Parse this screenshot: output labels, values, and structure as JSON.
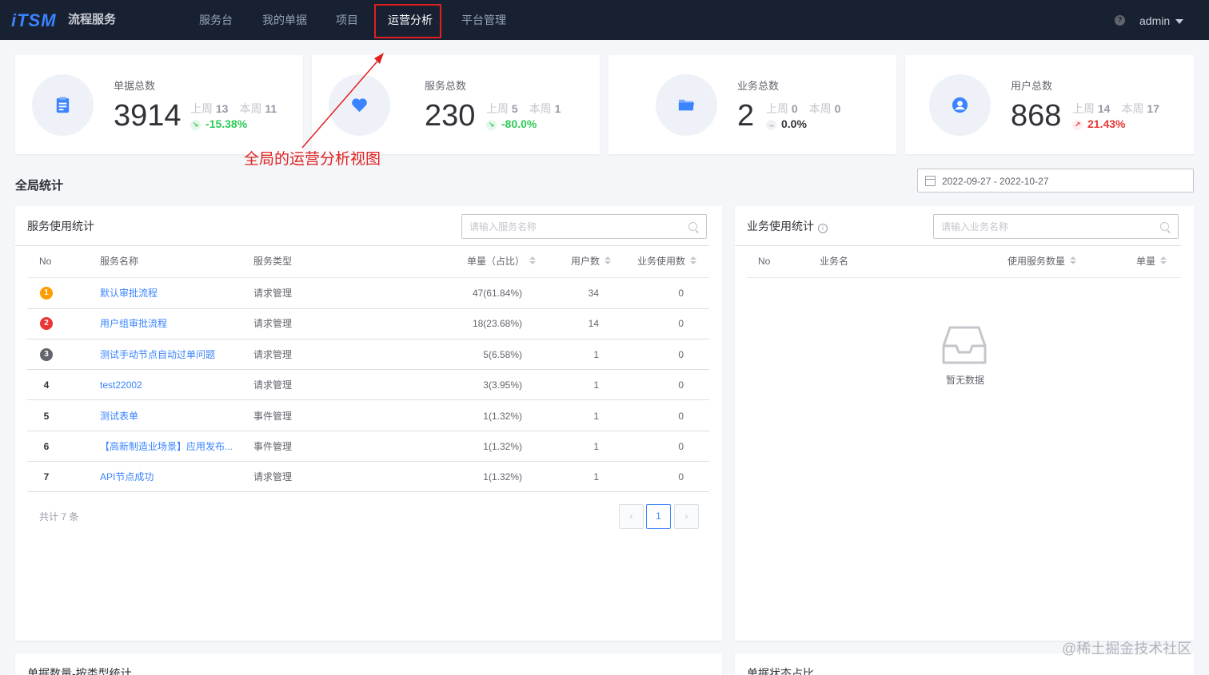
{
  "app": {
    "logo": "iTSM",
    "name": "流程服务"
  },
  "nav": {
    "items": [
      {
        "label": "服务台"
      },
      {
        "label": "我的单据"
      },
      {
        "label": "项目"
      },
      {
        "label": "运营分析"
      },
      {
        "label": "平台管理"
      }
    ],
    "active_index": 3,
    "user": "admin"
  },
  "stats": [
    {
      "label": "单据总数",
      "value": "3914",
      "last_week_label": "上周",
      "last_week": "13",
      "this_week_label": "本周",
      "this_week": "11",
      "change": "-15.38%",
      "trend": "down",
      "icon": "clipboard-icon"
    },
    {
      "label": "服务总数",
      "value": "230",
      "last_week_label": "上周",
      "last_week": "5",
      "this_week_label": "本周",
      "this_week": "1",
      "change": "-80.0%",
      "trend": "down",
      "icon": "heart-icon"
    },
    {
      "label": "业务总数",
      "value": "2",
      "last_week_label": "上周",
      "last_week": "0",
      "this_week_label": "本周",
      "this_week": "0",
      "change": "0.0%",
      "trend": "flat",
      "icon": "folder-icon"
    },
    {
      "label": "用户总数",
      "value": "868",
      "last_week_label": "上周",
      "last_week": "14",
      "this_week_label": "本周",
      "this_week": "17",
      "change": "21.43%",
      "trend": "up",
      "icon": "user-icon"
    }
  ],
  "annotation": "全局的运营分析视图",
  "section": {
    "title": "全局统计",
    "date_range": "2022-09-27 - 2022-10-27"
  },
  "service_panel": {
    "title": "服务使用统计",
    "search_placeholder": "请输入服务名称",
    "columns": [
      "No",
      "服务名称",
      "服务类型",
      "单量（占比）",
      "用户数",
      "业务使用数"
    ],
    "rows": [
      {
        "no": "1",
        "name": "默认审批流程",
        "type": "请求管理",
        "count": "47(61.84%)",
        "users": "34",
        "biz": "0"
      },
      {
        "no": "2",
        "name": "用户组审批流程",
        "type": "请求管理",
        "count": "18(23.68%)",
        "users": "14",
        "biz": "0"
      },
      {
        "no": "3",
        "name": "测试手动节点自动过单问题",
        "type": "请求管理",
        "count": "5(6.58%)",
        "users": "1",
        "biz": "0"
      },
      {
        "no": "4",
        "name": "test22002",
        "type": "请求管理",
        "count": "3(3.95%)",
        "users": "1",
        "biz": "0"
      },
      {
        "no": "5",
        "name": "测试表单",
        "type": "事件管理",
        "count": "1(1.32%)",
        "users": "1",
        "biz": "0"
      },
      {
        "no": "6",
        "name": "【高新制造业场景】应用发布...",
        "type": "事件管理",
        "count": "1(1.32%)",
        "users": "1",
        "biz": "0"
      },
      {
        "no": "7",
        "name": "API节点成功",
        "type": "请求管理",
        "count": "1(1.32%)",
        "users": "1",
        "biz": "0"
      }
    ],
    "total": "共计 7 条",
    "page": "1",
    "prev": "‹",
    "next": "›"
  },
  "business_panel": {
    "title": "业务使用统计",
    "search_placeholder": "请输入业务名称",
    "columns": [
      "No",
      "业务名",
      "使用服务数量",
      "单量"
    ],
    "empty_text": "暂无数据"
  },
  "bottom_panels": {
    "left_title": "单据数量-按类型统计",
    "right_title": "单据状态占比"
  },
  "watermark": "@稀土掘金技术社区",
  "colors": {
    "nav_bg": "#182132",
    "accent": "#3a84ff",
    "down": "#2dcb56",
    "up": "#ea3636",
    "annotation": "#e02020"
  }
}
